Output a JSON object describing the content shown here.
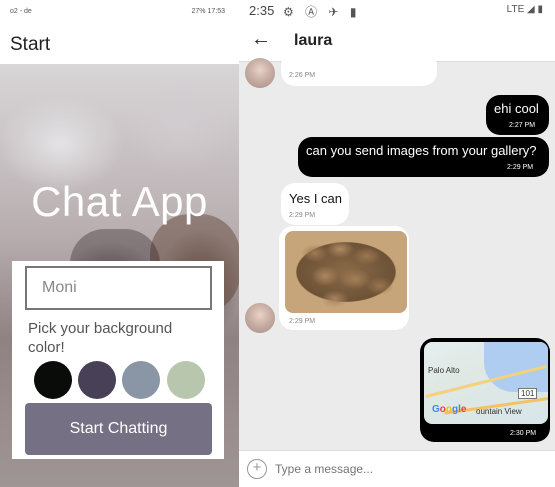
{
  "left_screen": {
    "status_left": "o2 - de",
    "status_right": "27% 17:53",
    "app_title": "Start",
    "hero_title": "Chat App",
    "name_input": {
      "value": "Moni",
      "placeholder": ""
    },
    "pick_label": "Pick your background color!",
    "swatches": [
      {
        "name": "black",
        "color": "#090C08"
      },
      {
        "name": "purple-gray",
        "color": "#474056"
      },
      {
        "name": "slate-blue",
        "color": "#8A95A5"
      },
      {
        "name": "sage-green",
        "color": "#B9C6AE"
      }
    ],
    "start_button": "Start Chatting",
    "button_color": "#757083"
  },
  "right_screen": {
    "status_time": "2:35",
    "status_right": "LTE",
    "back_icon": "arrow-left-icon",
    "chat_title": "laura",
    "messages": [
      {
        "side": "left",
        "text": "",
        "time": "2:26 PM"
      },
      {
        "side": "right",
        "text": "ehi cool",
        "time": "2:27 PM"
      },
      {
        "side": "right",
        "text": "can you send images from your gallery?",
        "time": "2:29 PM"
      },
      {
        "side": "left",
        "text": "Yes I can",
        "time": "2:29 PM"
      },
      {
        "side": "left",
        "type": "image",
        "image": "potatoes-photo",
        "time": "2:29 PM"
      },
      {
        "side": "right",
        "type": "map",
        "time": "2:30 PM"
      }
    ],
    "map_labels": {
      "city": "Palo Alto",
      "logo": "Google",
      "area": "ountain View",
      "route": "101"
    },
    "composer_placeholder": "Type a message...",
    "add_icon": "plus-circle-icon"
  }
}
